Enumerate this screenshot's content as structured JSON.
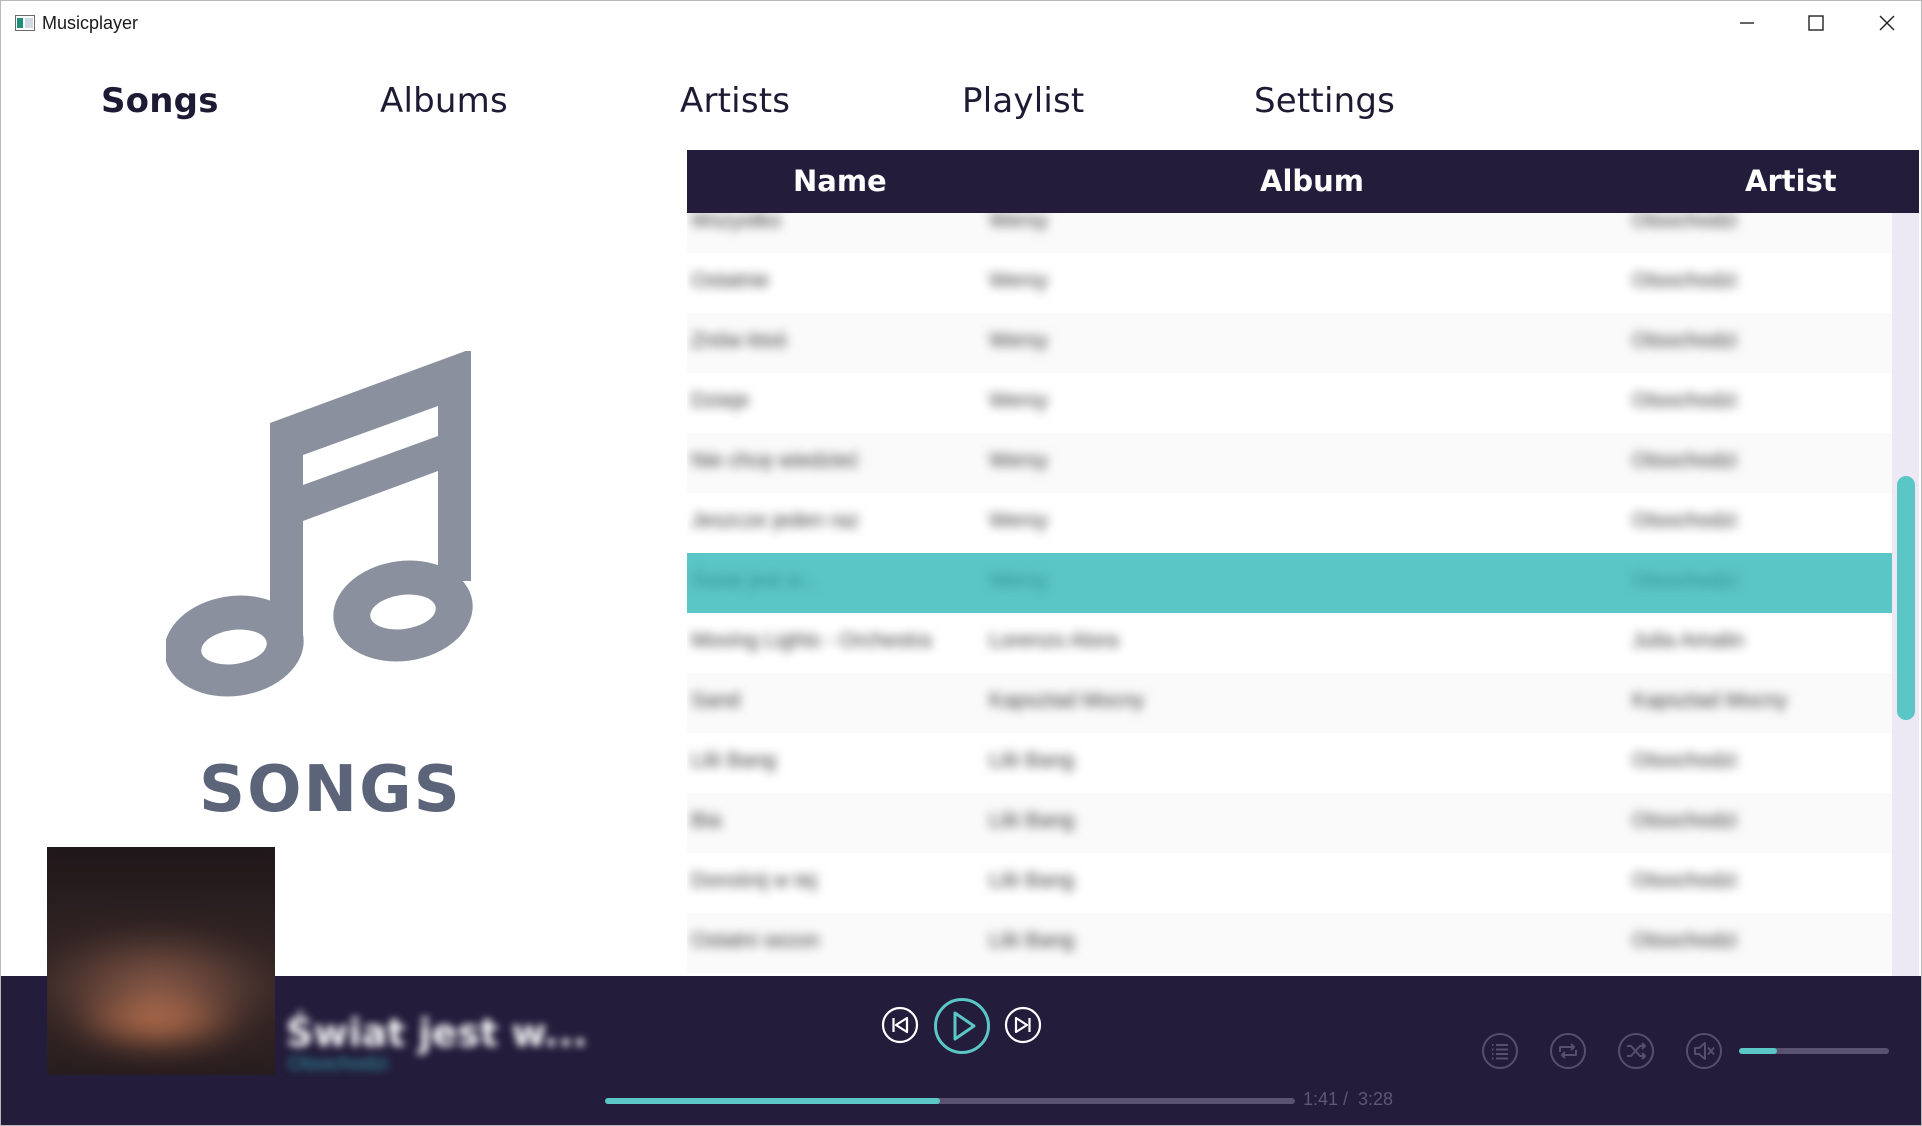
{
  "window": {
    "title": "Musicplayer"
  },
  "tabs": [
    {
      "label": "Songs",
      "active": true
    },
    {
      "label": "Albums",
      "active": false
    },
    {
      "label": "Artists",
      "active": false
    },
    {
      "label": "Playlist",
      "active": false
    },
    {
      "label": "Settings",
      "active": false
    }
  ],
  "hero": {
    "label": "SONGS",
    "icon": "music-note-icon"
  },
  "table": {
    "columns": [
      "Name",
      "Album",
      "Artist"
    ],
    "rows": [
      {
        "name": "Wszystko",
        "album": "Wersy",
        "artist": "Otsochodzi"
      },
      {
        "name": "Ostatnie",
        "album": "Wersy",
        "artist": "Otsochodzi"
      },
      {
        "name": "Znów ktoś",
        "album": "Wersy",
        "artist": "Otsochodzi"
      },
      {
        "name": "Dzieje",
        "album": "Wersy",
        "artist": "Otsochodzi"
      },
      {
        "name": "Nie chcę wiedzieć",
        "album": "Wersy",
        "artist": "Otsochodzi"
      },
      {
        "name": "Jeszcze jeden raz",
        "album": "Wersy",
        "artist": "Otsochodzi"
      },
      {
        "name": "Świat jest w...",
        "album": "Wersy",
        "artist": "Otsochodzi",
        "selected": true
      },
      {
        "name": "Moving Lights - Orchestra",
        "album": "Lorenzo Alora",
        "artist": "Julia Amalin"
      },
      {
        "name": "Sand",
        "album": "Kapsztad Mocny",
        "artist": "Kapsztad Mocny"
      },
      {
        "name": "Lilii Bang",
        "album": "Lilii Bang",
        "artist": "Otsochodzi"
      },
      {
        "name": "Bia",
        "album": "Lilii Bang",
        "artist": "Otsochodzi"
      },
      {
        "name": "Dorośnij w tej",
        "album": "Lilii Bang",
        "artist": "Otsochodzi"
      },
      {
        "name": "Ostatni sezon",
        "album": "Lilii Bang",
        "artist": "Otsochodzi"
      }
    ]
  },
  "player": {
    "track_title": "Świat jest w...",
    "track_artist": "Otsochodzi",
    "elapsed": "1:41",
    "separator": "/",
    "duration": "3:28",
    "progress": 0.485,
    "volume": 0.25,
    "accent": "#5bc6c6",
    "background": "#231c3b"
  }
}
